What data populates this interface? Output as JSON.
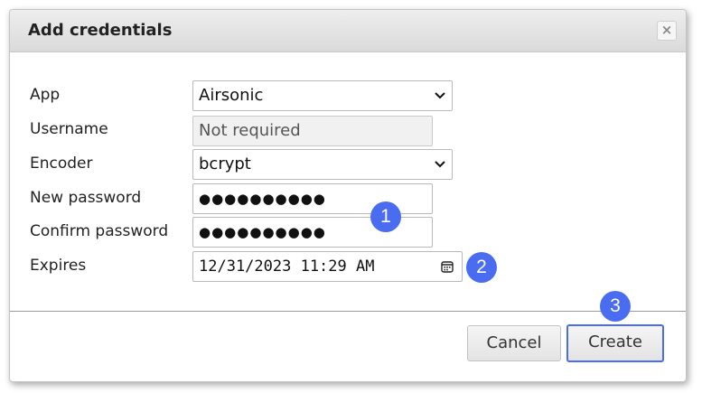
{
  "dialog": {
    "title": "Add credentials",
    "close_glyph": "×"
  },
  "form": {
    "app": {
      "label": "App",
      "value": "Airsonic"
    },
    "username": {
      "label": "Username",
      "placeholder": "Not required"
    },
    "encoder": {
      "label": "Encoder",
      "value": "bcrypt"
    },
    "new_password": {
      "label": "New password",
      "masked_value": "●●●●●●●●●●"
    },
    "confirm_password": {
      "label": "Confirm password",
      "masked_value": "●●●●●●●●●●"
    },
    "expires": {
      "label": "Expires",
      "value": "12/31/2023 11:29 AM"
    }
  },
  "annotations": {
    "badge_1": "1",
    "badge_2": "2",
    "badge_3": "3"
  },
  "footer": {
    "cancel_label": "Cancel",
    "create_label": "Create"
  },
  "colors": {
    "accent": "#4a6cf0"
  },
  "icons": {
    "select_arrow": "chevron-down-icon",
    "date_picker": "calendar-icon",
    "close": "close-icon"
  }
}
